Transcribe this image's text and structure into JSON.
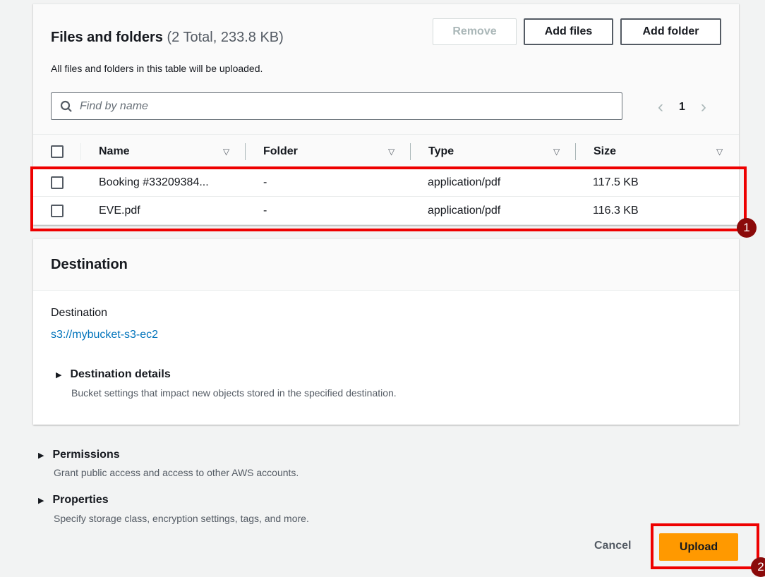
{
  "files": {
    "title": "Files and folders",
    "count": "(2 Total, 233.8 KB)",
    "subtitle": "All files and folders in this table will be uploaded.",
    "buttons": {
      "remove": "Remove",
      "add_files": "Add files",
      "add_folder": "Add folder"
    },
    "search_placeholder": "Find by name",
    "page": "1",
    "columns": [
      "Name",
      "Folder",
      "Type",
      "Size"
    ],
    "rows": [
      {
        "name": "Booking #33209384...",
        "folder": "-",
        "type": "application/pdf",
        "size": "117.5 KB"
      },
      {
        "name": "EVE.pdf",
        "folder": "-",
        "type": "application/pdf",
        "size": "116.3 KB"
      }
    ]
  },
  "destination": {
    "title": "Destination",
    "label": "Destination",
    "link": "s3://mybucket-s3-ec2",
    "details_title": "Destination details",
    "details_desc": "Bucket settings that impact new objects stored in the specified destination."
  },
  "permissions": {
    "title": "Permissions",
    "desc": "Grant public access and access to other AWS accounts."
  },
  "properties": {
    "title": "Properties",
    "desc": "Specify storage class, encryption settings, tags, and more."
  },
  "actions": {
    "cancel": "Cancel",
    "upload": "Upload"
  },
  "annotations": [
    "1",
    "2"
  ],
  "colors": {
    "accent": "#ff9900",
    "link": "#0073bb",
    "annotation": "#ee0000"
  }
}
